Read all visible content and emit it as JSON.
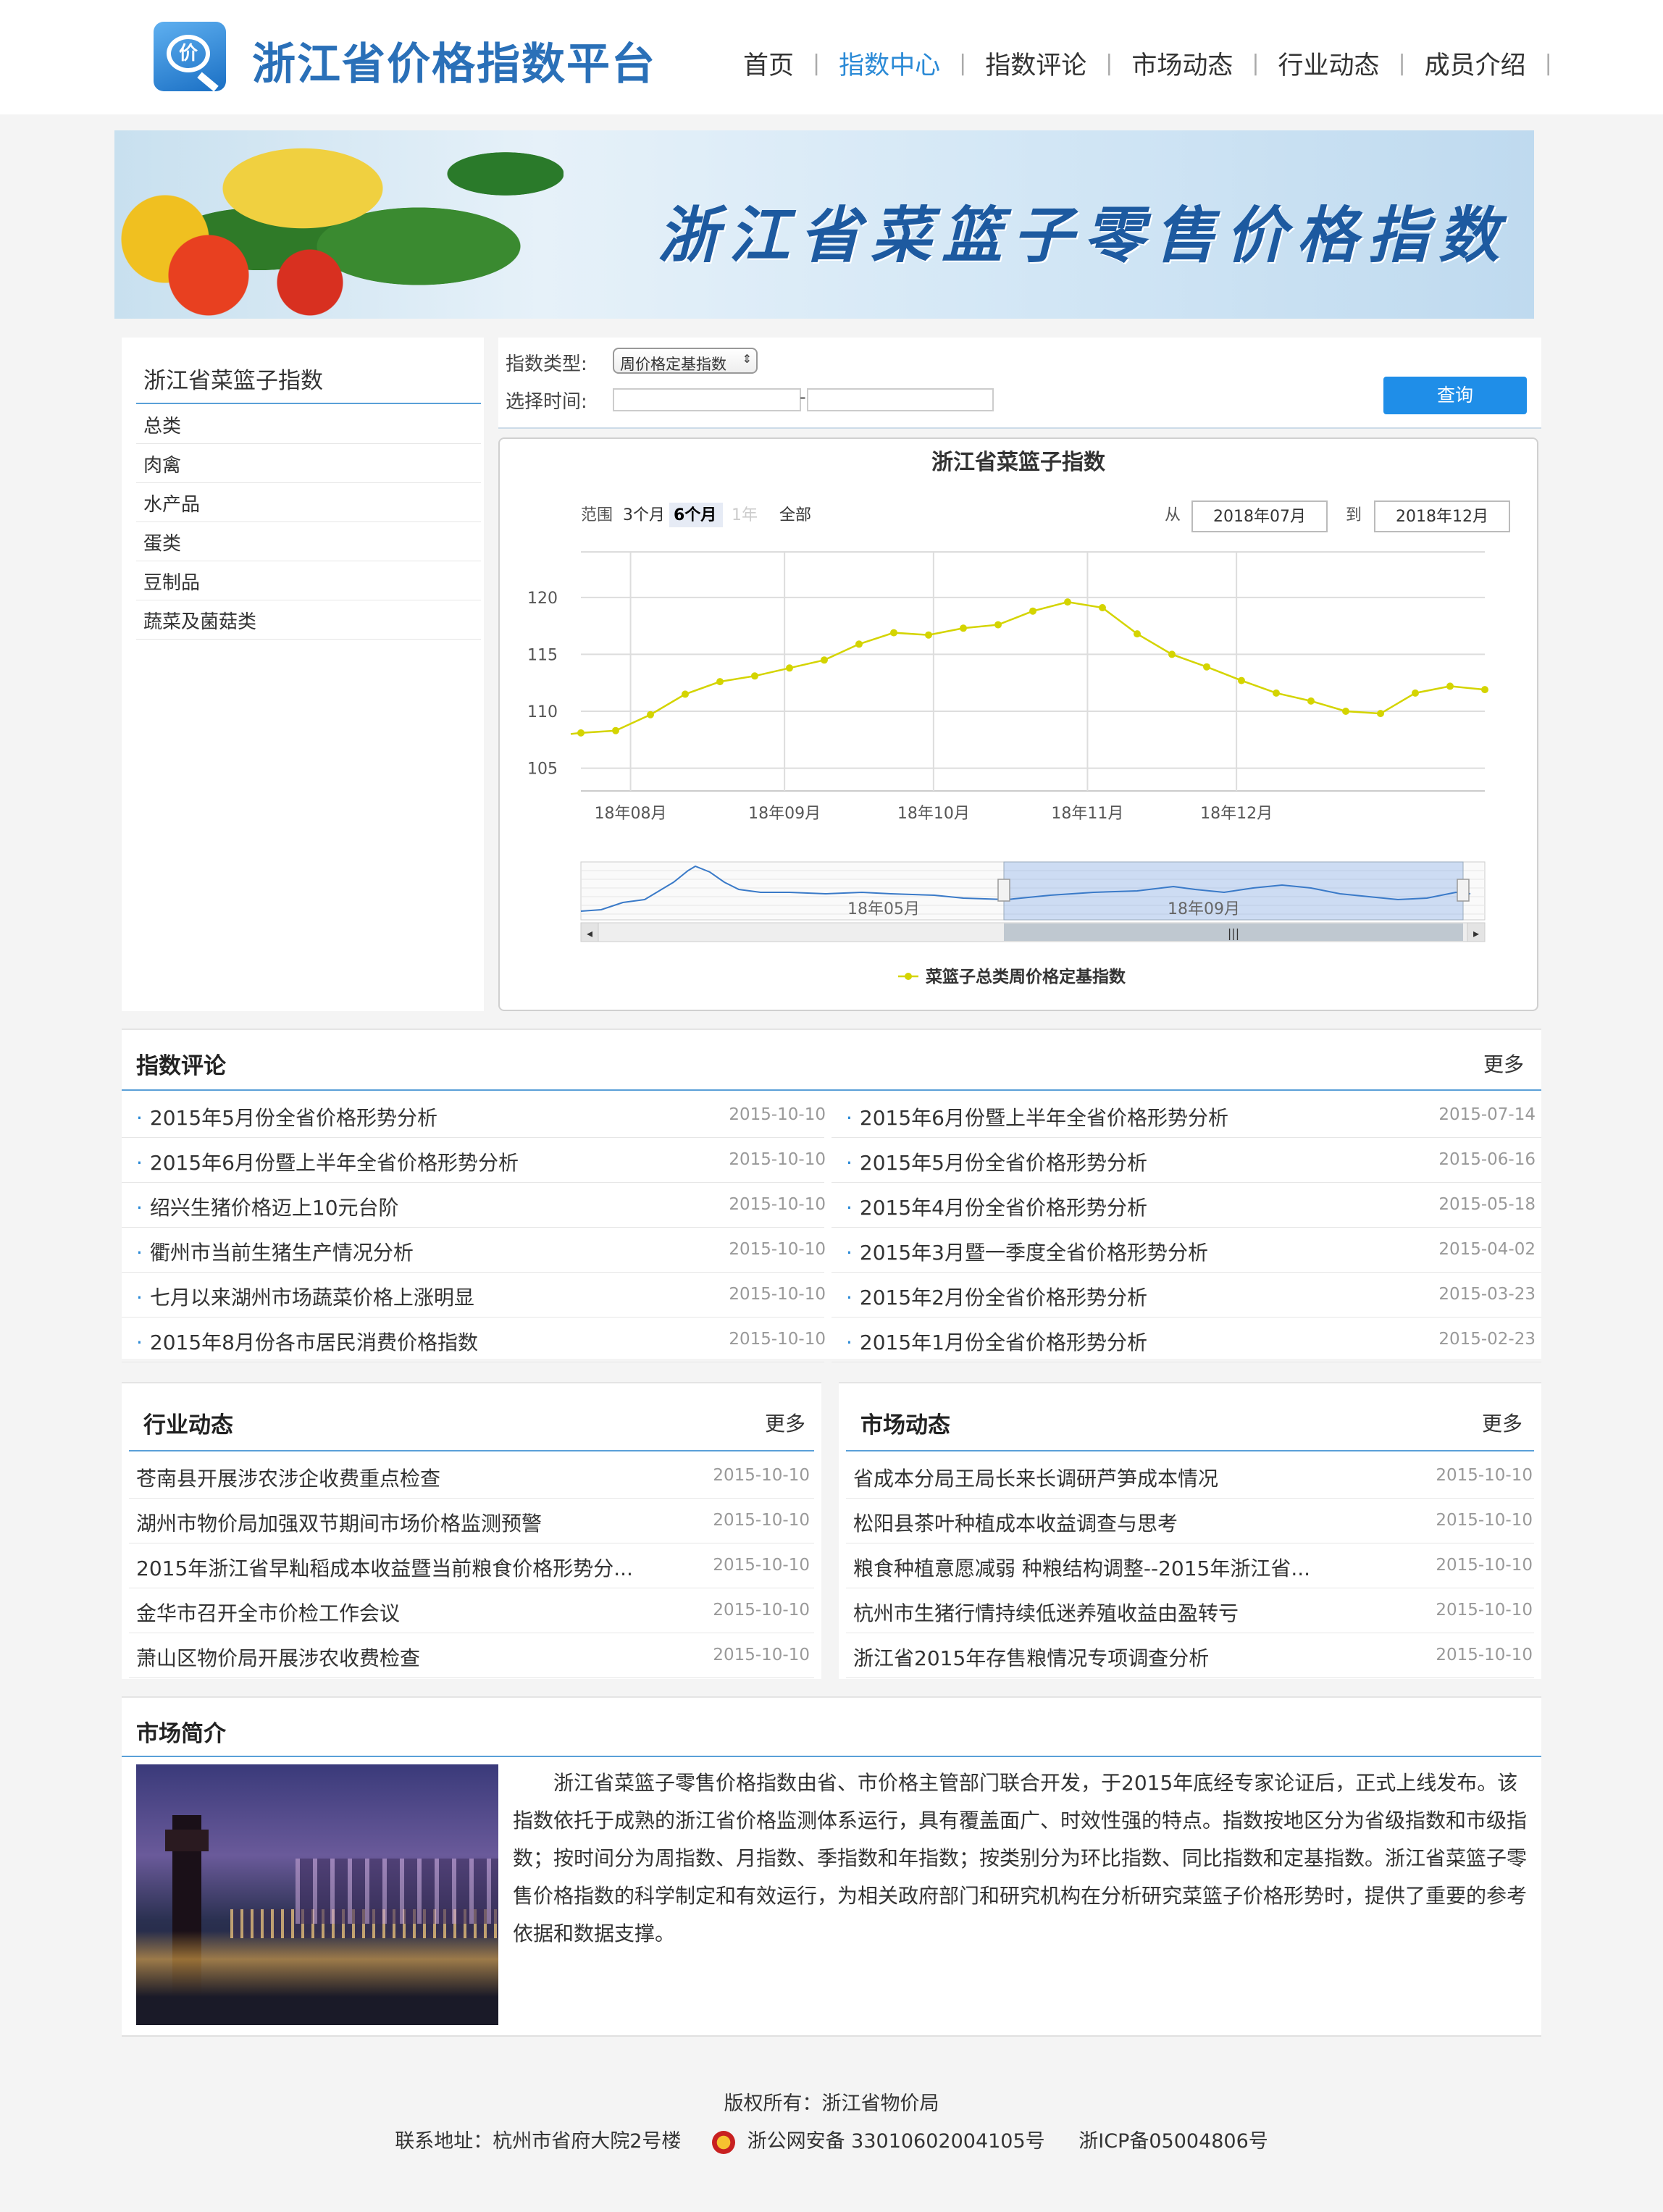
{
  "header": {
    "site_title": "浙江省价格指数平台",
    "logo_glyph": "价",
    "nav": [
      {
        "label": "首页",
        "active": false
      },
      {
        "label": "指数中心",
        "active": true
      },
      {
        "label": "指数评论",
        "active": false
      },
      {
        "label": "市场动态",
        "active": false
      },
      {
        "label": "行业动态",
        "active": false
      },
      {
        "label": "成员介绍",
        "active": false
      }
    ],
    "nav_separator": "|"
  },
  "banner": {
    "title": "浙江省菜篮子零售价格指数"
  },
  "sidebar": {
    "title": "浙江省菜篮子指数",
    "items": [
      "总类",
      "肉禽",
      "水产品",
      "蛋类",
      "豆制品",
      "蔬菜及菌菇类"
    ]
  },
  "query": {
    "type_label": "指数类型:",
    "type_value": "周价格定基指数",
    "time_label": "选择时间:",
    "dash": "-",
    "button": "查询"
  },
  "chart": {
    "range_label": "范围",
    "range_buttons": [
      "3个月",
      "6个月",
      "1年",
      "全部"
    ],
    "from_label": "从",
    "from_value": "2018年07月",
    "to_label": "到",
    "to_value": "2018年12月",
    "navigator_labels": [
      "18年05月",
      "18年09月"
    ]
  },
  "chart_data": {
    "type": "line",
    "title": "浙江省菜篮子指数",
    "xlabel": "",
    "ylabel": "",
    "x": [
      "2018-07-22",
      "2018-07-29",
      "2018-08-05",
      "2018-08-12",
      "2018-08-19",
      "2018-08-26",
      "2018-09-02",
      "2018-09-09",
      "2018-09-16",
      "2018-09-23",
      "2018-09-30",
      "2018-10-07",
      "2018-10-14",
      "2018-10-21",
      "2018-10-28",
      "2018-11-04",
      "2018-11-11",
      "2018-11-18",
      "2018-11-25",
      "2018-12-02",
      "2018-12-09",
      "2018-12-16",
      "2018-12-23",
      "2018-12-30",
      "2019-01-06",
      "2019-01-13",
      "2019-01-20"
    ],
    "series": [
      {
        "name": "菜篮子总类周价格定基指数",
        "color": "#d4d400",
        "values": [
          108.1,
          108.3,
          109.7,
          111.5,
          112.6,
          113.1,
          113.8,
          114.5,
          115.9,
          116.9,
          116.7,
          117.3,
          117.6,
          118.8,
          119.6,
          119.1,
          116.8,
          115.0,
          113.9,
          112.7,
          111.6,
          110.9,
          110.0,
          109.8,
          111.6,
          112.2,
          111.9
        ]
      }
    ],
    "x_ticks": [
      "18年08月",
      "18年09月",
      "18年10月",
      "18年11月",
      "18年12月"
    ],
    "y_ticks": [
      105,
      110,
      115,
      120
    ],
    "ylim": [
      103,
      124
    ],
    "grid": true,
    "legend": "bottom"
  },
  "commentary": {
    "title": "指数评论",
    "more": "更多",
    "left": [
      {
        "title": "2015年5月份全省价格形势分析",
        "date": "2015-10-10"
      },
      {
        "title": "2015年6月份暨上半年全省价格形势分析",
        "date": "2015-10-10"
      },
      {
        "title": "绍兴生猪价格迈上10元台阶",
        "date": "2015-10-10"
      },
      {
        "title": "衢州市当前生猪生产情况分析",
        "date": "2015-10-10"
      },
      {
        "title": "七月以来湖州市场蔬菜价格上涨明显",
        "date": "2015-10-10"
      },
      {
        "title": "2015年8月份各市居民消费价格指数",
        "date": "2015-10-10"
      }
    ],
    "right": [
      {
        "title": "2015年6月份暨上半年全省价格形势分析",
        "date": "2015-07-14"
      },
      {
        "title": "2015年5月份全省价格形势分析",
        "date": "2015-06-16"
      },
      {
        "title": "2015年4月份全省价格形势分析",
        "date": "2015-05-18"
      },
      {
        "title": "2015年3月暨一季度全省价格形势分析",
        "date": "2015-04-02"
      },
      {
        "title": "2015年2月份全省价格形势分析",
        "date": "2015-03-23"
      },
      {
        "title": "2015年1月份全省价格形势分析",
        "date": "2015-02-23"
      }
    ]
  },
  "industry": {
    "title": "行业动态",
    "more": "更多",
    "items": [
      {
        "title": "苍南县开展涉农涉企收费重点检查",
        "date": "2015-10-10"
      },
      {
        "title": "湖州市物价局加强双节期间市场价格监测预警",
        "date": "2015-10-10"
      },
      {
        "title": "2015年浙江省早籼稻成本收益暨当前粮食价格形势分...",
        "date": "2015-10-10"
      },
      {
        "title": "金华市召开全市价检工作会议",
        "date": "2015-10-10"
      },
      {
        "title": "萧山区物价局开展涉农收费检查",
        "date": "2015-10-10"
      }
    ]
  },
  "market": {
    "title": "市场动态",
    "more": "更多",
    "items": [
      {
        "title": "省成本分局王局长来长调研芦笋成本情况",
        "date": "2015-10-10"
      },
      {
        "title": "松阳县茶叶种植成本收益调查与思考",
        "date": "2015-10-10"
      },
      {
        "title": "粮食种植意愿减弱 种粮结构调整--2015年浙江省...",
        "date": "2015-10-10"
      },
      {
        "title": "杭州市生猪行情持续低迷养殖收益由盈转亏",
        "date": "2015-10-10"
      },
      {
        "title": "浙江省2015年存售粮情况专项调查分析",
        "date": "2015-10-10"
      }
    ]
  },
  "intro": {
    "title": "市场简介",
    "text": "浙江省菜篮子零售价格指数由省、市价格主管部门联合开发，于2015年底经专家论证后，正式上线发布。该指数依托于成熟的浙江省价格监测体系运行，具有覆盖面广、时效性强的特点。指数按地区分为省级指数和市级指数；按时间分为周指数、月指数、季指数和年指数；按类别分为环比指数、同比指数和定基指数。浙江省菜篮子零售价格指数的科学制定和有效运行，为相关政府部门和研究机构在分析研究菜篮子价格形势时，提供了重要的参考依据和数据支撑。"
  },
  "footer": {
    "copyright": "版权所有：浙江省物价局",
    "address": "联系地址：杭州市省府大院2号楼",
    "police": "浙公网安备 33010602004105号",
    "icp": "浙ICP备05004806号"
  }
}
